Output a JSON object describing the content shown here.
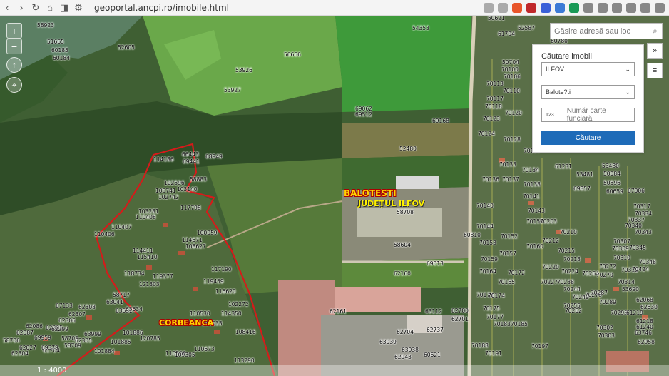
{
  "browser": {
    "url": "geoportal.ancpi.ro/imobile.html",
    "back_icon": "‹",
    "forward_icon": "›",
    "reload_icon": "↻",
    "home_icon": "⌂",
    "bookmark_icon": "◨",
    "site_icon": "⚙"
  },
  "map_controls": {
    "zoom_in": "+",
    "zoom_out": "−",
    "north": "↑",
    "locate": "⌖",
    "scale": "1 : 4000"
  },
  "search": {
    "placeholder": "Găsire adresă sau loc",
    "icon": "⌕"
  },
  "side_buttons": {
    "expand": "»",
    "legend": "≡"
  },
  "panel": {
    "title": "Căutare imobil",
    "county": "ILFOV",
    "locality": "Balote?ti",
    "cf_prefix": "123",
    "cf_placeholder": "Număr carte funciară",
    "button": "Căutare"
  },
  "place_labels": {
    "baloteti": "BALOTESTI",
    "judet": "JUDEȚUL ILFOV",
    "corbeanca": "CORBEANCA"
  },
  "parcels": [
    "58923",
    "51665",
    "60185",
    "60184",
    "52605",
    "53926",
    "53927",
    "56666",
    "54353",
    "60780",
    "60772",
    "69062",
    "69512",
    "69168",
    "52480",
    "68949",
    "114186",
    "66443",
    "69441",
    "58883",
    "102596",
    "105741",
    "102742",
    "103140",
    "117798",
    "103281",
    "110407",
    "110406",
    "110408",
    "100059",
    "114671",
    "108627",
    "114411",
    "115410",
    "117190",
    "118734",
    "119377",
    "121303",
    "119459",
    "116620",
    "102272",
    "110530",
    "114350",
    "114033",
    "101886",
    "101885",
    "120785",
    "108416",
    "101884",
    "110506",
    "109305",
    "110673",
    "113290",
    "58717",
    "63041",
    "63632",
    "63634",
    "62308",
    "67133",
    "62307",
    "62306",
    "62305",
    "62304",
    "63999",
    "61704",
    "62086",
    "62087",
    "69959",
    "62299",
    "58709",
    "69379",
    "58705",
    "58706",
    "62027",
    "62305",
    "58708",
    "58604",
    "60810",
    "69013",
    "62160",
    "62161",
    "63112",
    "62700",
    "62701",
    "62704",
    "62737",
    "63038",
    "63039",
    "60621",
    "62943",
    "50621",
    "61704",
    "52587",
    "50704",
    "70100",
    "70106",
    "70113",
    "70110",
    "70117",
    "70118",
    "70120",
    "70123",
    "70124",
    "70128",
    "70129",
    "70133",
    "70134",
    "70136",
    "70137",
    "70138",
    "70140",
    "70141",
    "70143",
    "70144",
    "70150",
    "70152",
    "70153",
    "70157",
    "70159",
    "70160",
    "70164",
    "70165",
    "70172",
    "70173",
    "70174",
    "70175",
    "70177",
    "70183",
    "70185",
    "70188",
    "70191",
    "70197",
    "70203",
    "70210",
    "70212",
    "70215",
    "70218",
    "70220",
    "70224",
    "70227",
    "70238",
    "70244",
    "70249",
    "70255",
    "70262",
    "70264",
    "70270",
    "70272",
    "70278",
    "70287",
    "70289",
    "70295",
    "70302",
    "70303",
    "70307",
    "70309",
    "70310",
    "70312",
    "70314",
    "70317",
    "70334",
    "70337",
    "70340",
    "70343",
    "70345",
    "70348",
    "70424",
    "53690",
    "62068",
    "62630",
    "61219",
    "61218",
    "61240",
    "63746",
    "62958",
    "61231",
    "53481",
    "53480",
    "50084",
    "50596",
    "60659",
    "67006",
    "69857"
  ]
}
